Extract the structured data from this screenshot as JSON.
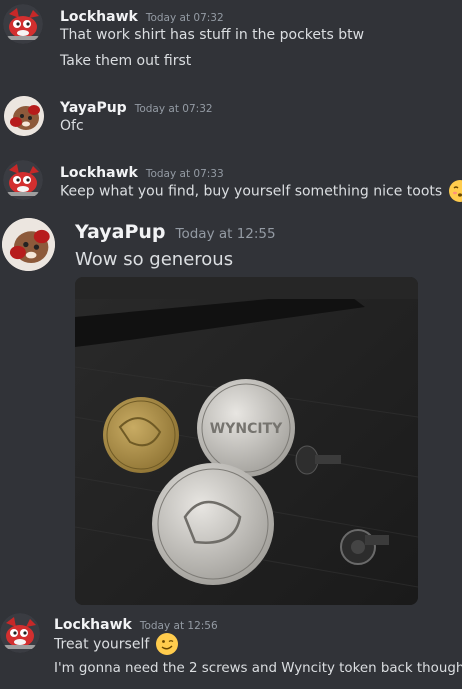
{
  "messages": [
    {
      "author": "Lockhawk",
      "time": "Today at 07:32",
      "lines": [
        "That work shirt has stuff in the pockets btw",
        "Take them out first"
      ]
    },
    {
      "author": "YayaPup",
      "time": "Today at 07:32",
      "lines": [
        "Ofc"
      ]
    },
    {
      "author": "Lockhawk",
      "time": "Today at 07:33",
      "lines": [
        "Keep what you find, buy yourself something nice toots"
      ],
      "emoji": "kissing-face-emoji"
    },
    {
      "author": "YayaPup",
      "time": "Today at 12:55",
      "lines": [
        "Wow so generous"
      ],
      "attachment": "photo of coins and screws on a dark desk"
    },
    {
      "author": "Lockhawk",
      "time": "Today at 12:56",
      "lines": [
        "Treat yourself",
        "I'm gonna need the 2 screws and Wyncity token back though"
      ],
      "emoji": "winking-face-emoji"
    }
  ],
  "colors": {
    "background": "#313338",
    "username": "#f2f3f5",
    "timestamp": "#949ba4",
    "text": "#dbdee1"
  }
}
